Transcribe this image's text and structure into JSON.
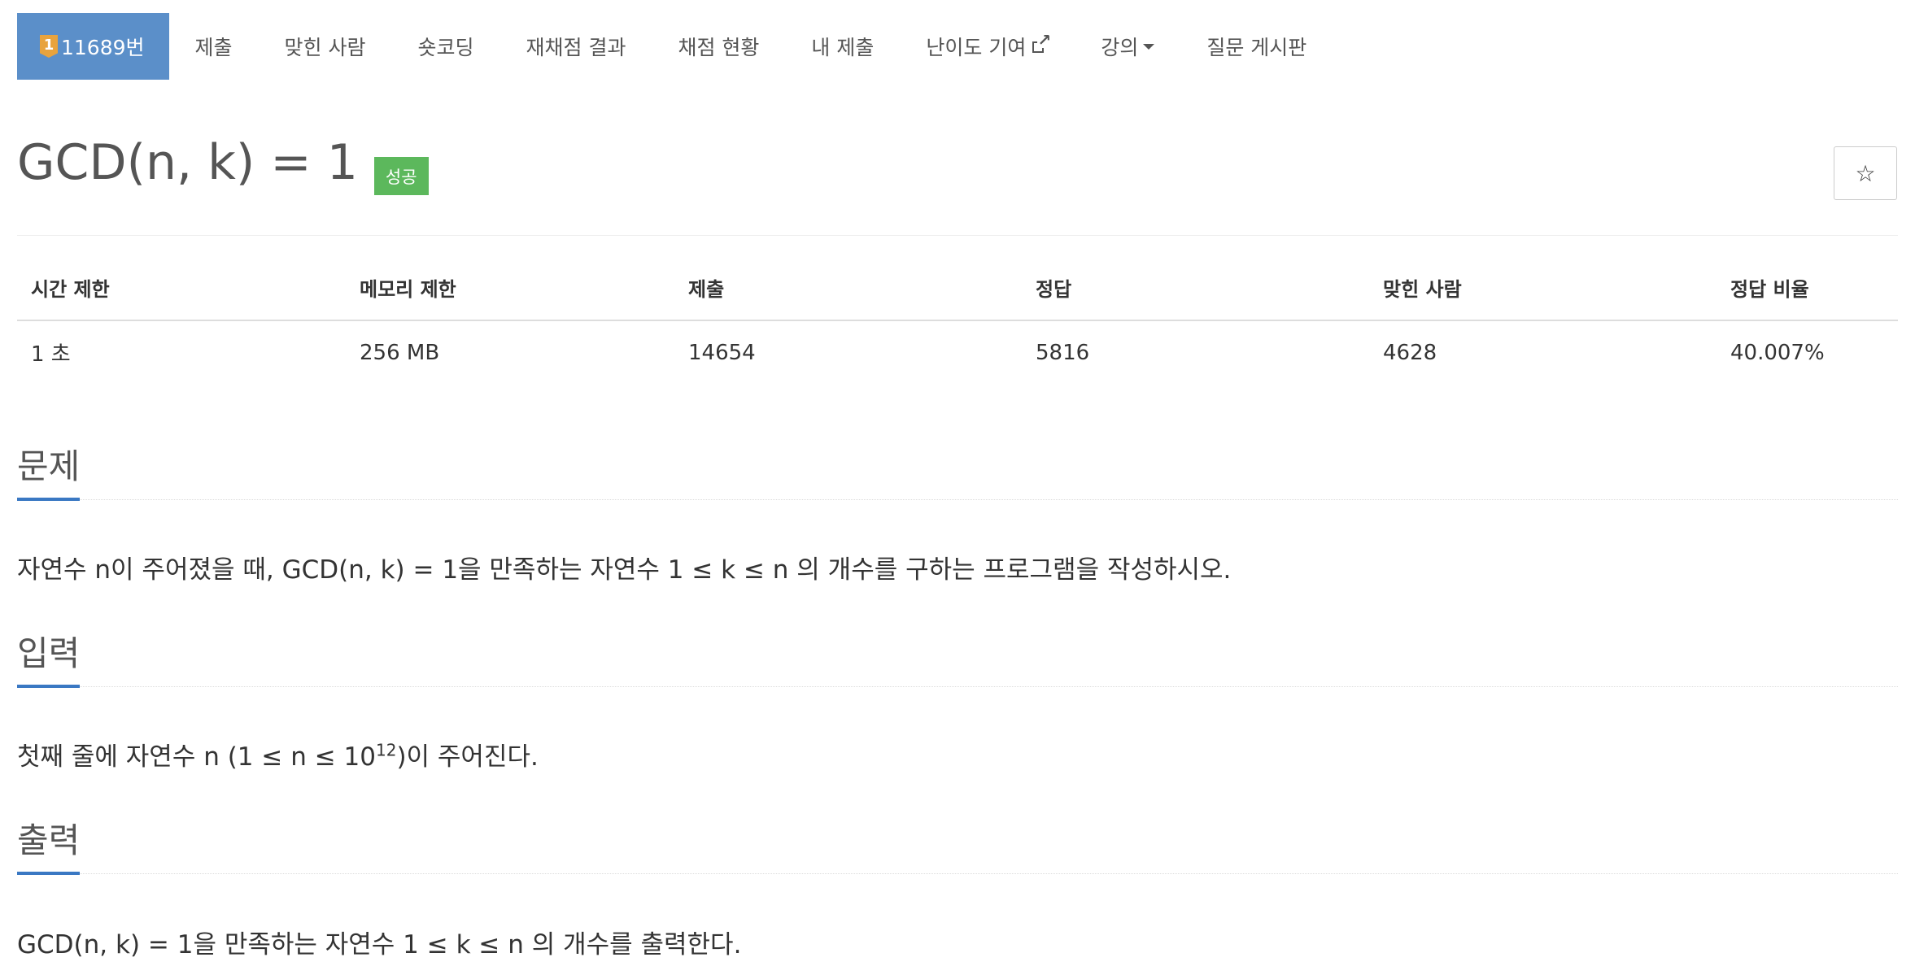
{
  "nav": {
    "problem_number": "11689번",
    "badge_digit": "1",
    "submit": "제출",
    "solved_users": "맞힌 사람",
    "shortcoding": "숏코딩",
    "rejudge": "재채점 결과",
    "status": "채점 현황",
    "my_submissions": "내 제출",
    "difficulty": "난이도 기여",
    "lecture": "강의",
    "board": "질문 게시판"
  },
  "problem": {
    "title": "GCD(n, k) = 1",
    "status_badge": "성공",
    "star": "☆"
  },
  "info_table": {
    "headers": [
      "시간 제한",
      "메모리 제한",
      "제출",
      "정답",
      "맞힌 사람",
      "정답 비율"
    ],
    "values": [
      "1 초",
      "256 MB",
      "14654",
      "5816",
      "4628",
      "40.007%"
    ]
  },
  "sections": {
    "description": {
      "heading": "문제",
      "text": "자연수 n이 주어졌을 때, GCD(n, k) = 1을 만족하는 자연수 1 ≤ k ≤ n 의 개수를 구하는 프로그램을 작성하시오."
    },
    "input": {
      "heading": "입력",
      "text_before": "첫째 줄에 자연수 n (1 ≤ n ≤ 10",
      "sup": "12",
      "text_after": ")이 주어진다."
    },
    "output": {
      "heading": "출력",
      "text": "GCD(n, k) = 1을 만족하는 자연수 1 ≤ k ≤ n 의 개수를 출력한다."
    }
  },
  "colors": {
    "nav_active": "#5b8fc9",
    "badge_success": "#5cb85c",
    "section_accent": "#3a78c3",
    "tier_badge": "#e8a33d"
  }
}
